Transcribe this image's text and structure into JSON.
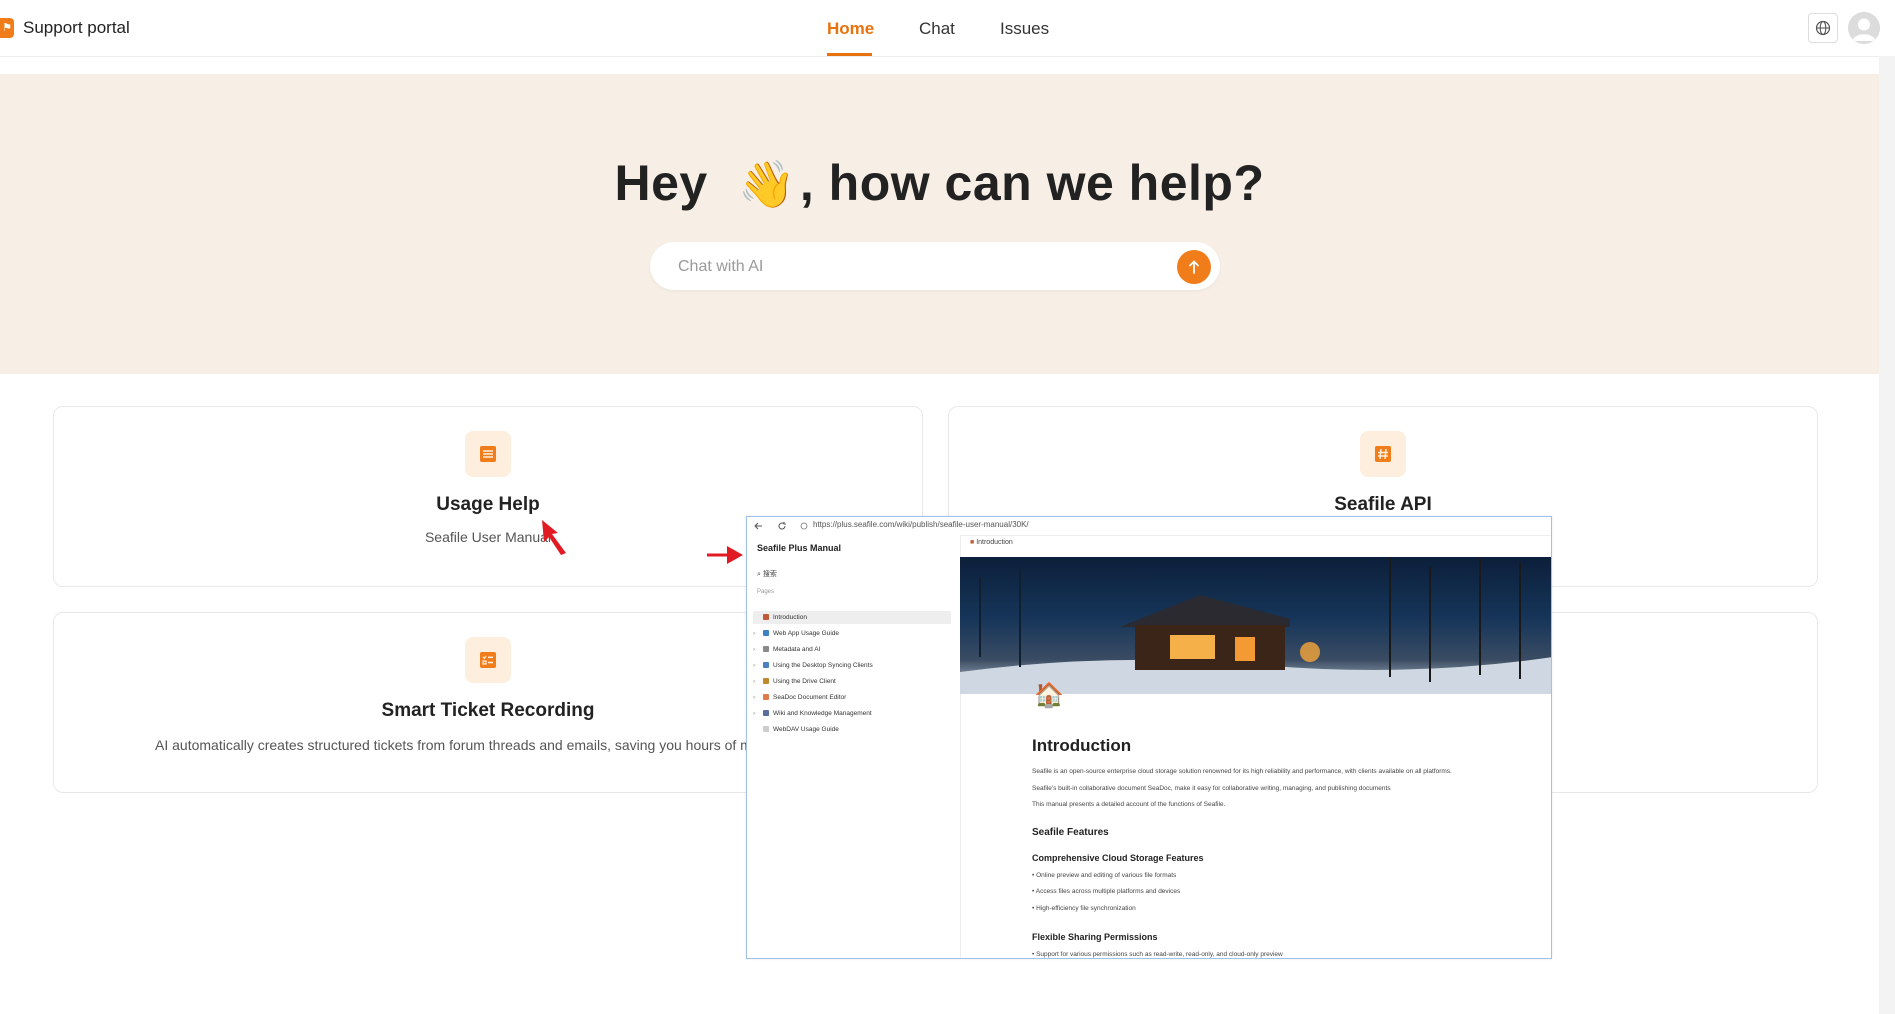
{
  "header": {
    "brand": "Support portal",
    "logo_glyph": "⚑",
    "nav": [
      {
        "label": "Home",
        "active": true
      },
      {
        "label": "Chat",
        "active": false
      },
      {
        "label": "Issues",
        "active": false
      }
    ],
    "icons": {
      "language": "globe-icon",
      "account": "avatar-icon"
    },
    "accent_color": "#e8730e"
  },
  "hero": {
    "title_before": "Hey",
    "emoji": "👋",
    "title_after": ", how can we help?",
    "chat_placeholder": "Chat with AI",
    "send_icon": "arrow-up-icon"
  },
  "cards": [
    {
      "title": "Usage Help",
      "desc": "Seafile User Manual",
      "icon": "list-icon"
    },
    {
      "title": "Seafile API",
      "desc": "",
      "icon": "hash-icon"
    },
    {
      "title": "Smart Ticket Recording",
      "desc": "AI automatically creates structured tickets from forum threads and emails, saving you hours of m",
      "icon": "ticket-list-icon"
    },
    {
      "title": "",
      "desc": "",
      "icon": ""
    }
  ],
  "overlay": {
    "url": "https://plus.seafile.com/wiki/publish/seafile-user-manual/30K/",
    "side_title": "Seafile Plus Manual",
    "search": "搜索",
    "pages_label": "Pages",
    "pages": [
      {
        "label": "Introduction",
        "selected": true,
        "expandable": false,
        "color": "#c05a3a"
      },
      {
        "label": "Web App Usage Guide",
        "selected": false,
        "expandable": true,
        "color": "#3b82c4"
      },
      {
        "label": "Metadata and AI",
        "selected": false,
        "expandable": true,
        "color": "#8a8a8a"
      },
      {
        "label": "Using the Desktop Syncing Clients",
        "selected": false,
        "expandable": true,
        "color": "#4a7fc0"
      },
      {
        "label": "Using the Drive Client",
        "selected": false,
        "expandable": true,
        "color": "#c08a2a"
      },
      {
        "label": "SeaDoc Document Editor",
        "selected": false,
        "expandable": true,
        "color": "#e07b4a"
      },
      {
        "label": "Wiki and Knowledge Management",
        "selected": false,
        "expandable": true,
        "color": "#5a6fa0"
      },
      {
        "label": "WebDAV Usage Guide",
        "selected": false,
        "expandable": false,
        "color": "#cccccc"
      }
    ],
    "crumb": "Introduction",
    "heading": "Introduction",
    "paragraphs": [
      "Seafile is an open-source enterprise cloud storage solution renowned for its high reliability and performance, with clients available on all platforms.",
      "Seafile's built-in collaborative document SeaDoc, make it easy for collaborative writing, managing, and publishing documents",
      "This manual presents a detailed account of the functions of Seafile."
    ],
    "features_heading": "Seafile Features",
    "section1_heading": "Comprehensive Cloud Storage Features",
    "section1_items": [
      "Online preview and editing of various file formats",
      "Access files across multiple platforms and devices",
      "High-efficiency file synchronization"
    ],
    "section2_heading": "Flexible Sharing Permissions",
    "section2_items": [
      "Support for various permissions such as read-write, read-only, and cloud-only preview"
    ]
  }
}
